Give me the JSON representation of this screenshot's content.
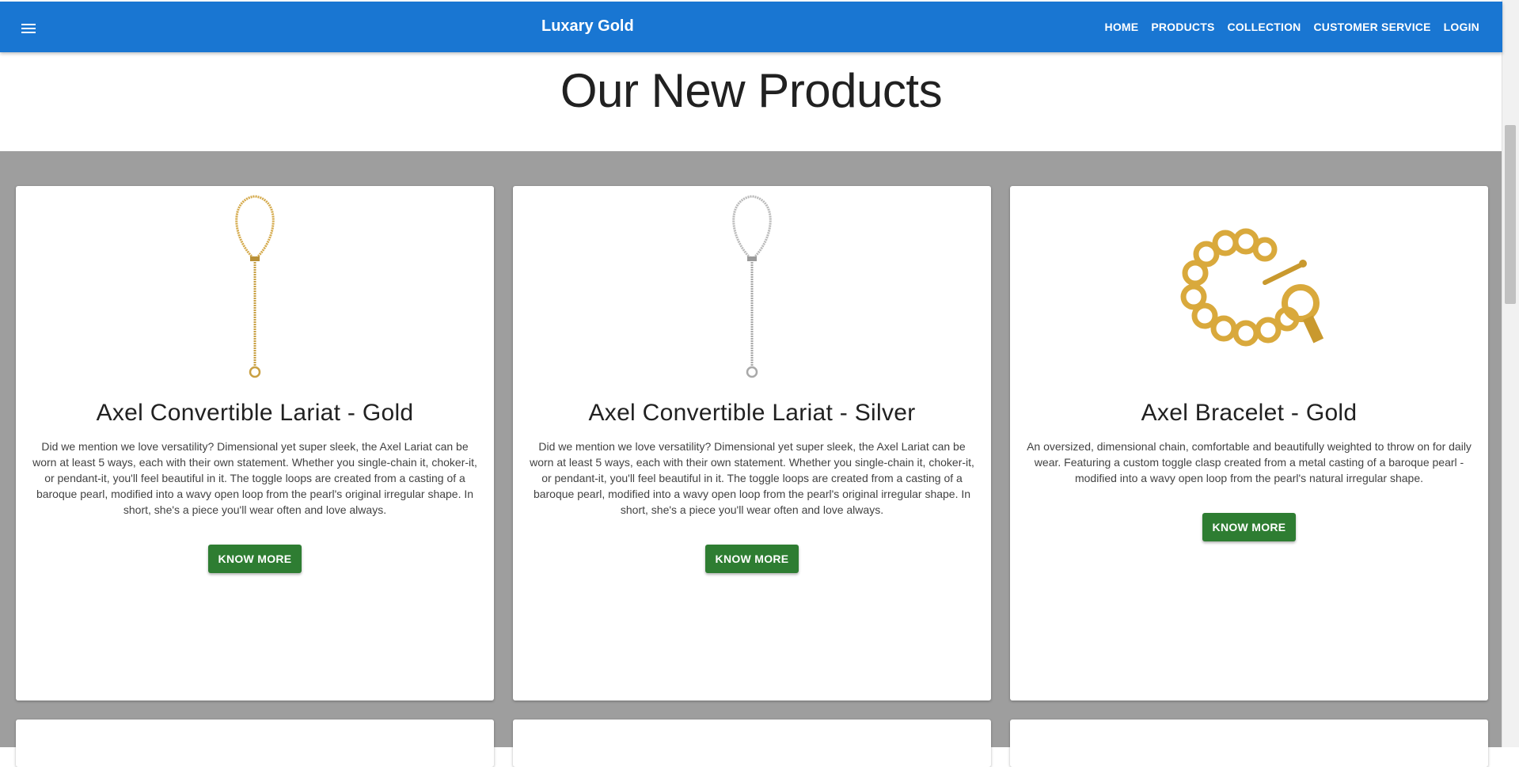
{
  "header": {
    "brand": "Luxary Gold",
    "nav": [
      "HOME",
      "PRODUCTS",
      "COLLECTION",
      "CUSTOMER SERVICE",
      "LOGIN"
    ],
    "color": "#1976d2"
  },
  "main": {
    "heading": "Our New Products",
    "section_bg": "#9e9e9e",
    "button_color": "#2e7d32",
    "products": [
      {
        "title": "Axel Convertible Lariat - Gold",
        "image": "gold-lariat-necklace-image",
        "description": "Did we mention we love versatility? Dimensional yet super sleek, the Axel Lariat can be worn at least 5 ways, each with their own statement. Whether you single-chain it, choker-it, or pendant-it, you'll feel beautiful in it. The toggle loops are created from a casting of a baroque pearl, modified into a wavy open loop from the pearl's original irregular shape. In short, she's a piece you'll wear often and love always.",
        "button": "KNOW MORE"
      },
      {
        "title": "Axel Convertible Lariat - Silver",
        "image": "silver-lariat-necklace-image",
        "description": "Did we mention we love versatility? Dimensional yet super sleek, the Axel Lariat can be worn at least 5 ways, each with their own statement. Whether you single-chain it, choker-it, or pendant-it, you'll feel beautiful in it. The toggle loops are created from a casting of a baroque pearl, modified into a wavy open loop from the pearl's original irregular shape. In short, she's a piece you'll wear often and love always.",
        "button": "KNOW MORE"
      },
      {
        "title": "Axel Bracelet - Gold",
        "image": "gold-bracelet-image",
        "description": "An oversized, dimensional chain, comfortable and beautifully weighted to throw on for daily wear. Featuring a custom toggle clasp created from a metal casting of a baroque pearl - modified into a wavy open loop from the pearl's natural irregular shape.",
        "button": "KNOW MORE"
      }
    ]
  }
}
